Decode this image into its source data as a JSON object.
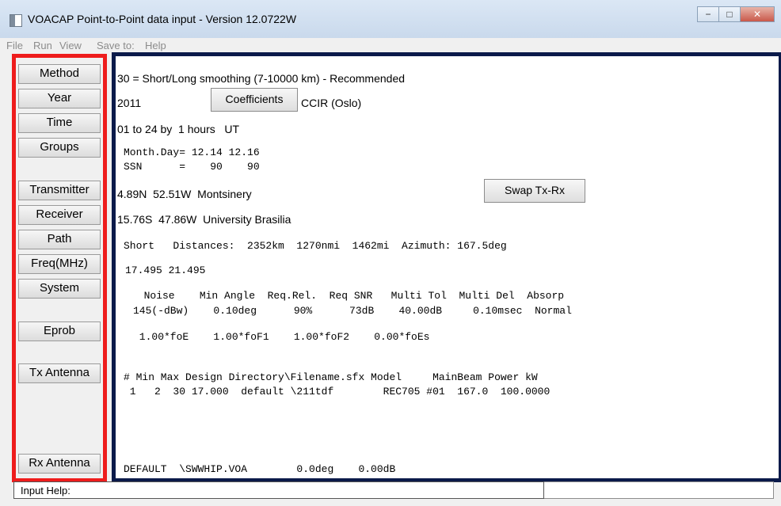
{
  "window": {
    "title": "VOACAP Point-to-Point data input - Version 12.0722W",
    "minimize_glyph": "−",
    "maximize_glyph": "□",
    "close_glyph": "✕"
  },
  "menu": [
    "File",
    "Run",
    "View",
    "Save to:",
    "Help"
  ],
  "sidebar": {
    "method": "Method",
    "year": "Year",
    "time": "Time",
    "groups": "Groups",
    "transmitter": "Transmitter",
    "receiver": "Receiver",
    "path": "Path",
    "freq": "Freq(MHz)",
    "system": "System",
    "eprob": "Eprob",
    "tx_antenna": "Tx Antenna",
    "rx_antenna": "Rx Antenna"
  },
  "main": {
    "method_line": "30 = Short/Long smoothing (7-10000 km) - Recommended",
    "year": "2011",
    "coefficients_button": "Coefficients",
    "coefficients_value": "CCIR (Oslo)",
    "time_line": "01 to 24 by  1 hours   UT",
    "month_day_line": "Month.Day= 12.14 12.16",
    "ssn_line": "SSN      =    90    90",
    "transmitter_line": "4.89N  52.51W  Montsinery",
    "swap_button": "Swap Tx-Rx",
    "receiver_line": "15.76S  47.86W  University Brasilia",
    "path_line": "Short   Distances:  2352km  1270nmi  1462mi  Azimuth: 167.5deg",
    "freq_line": "17.495 21.495",
    "system_header": "  Noise    Min Angle  Req.Rel.  Req SNR   Multi Tol  Multi Del  Absorp",
    "system_values": "145(-dBw)    0.10deg      90%      73dB    40.00dB     0.10msec  Normal",
    "eprob_line": " 1.00*foE    1.00*foF1    1.00*foF2    0.00*foEs",
    "tx_header": "# Min Max Design Directory\\Filename.sfx Model     MainBeam Power kW",
    "tx_values": " 1   2  30 17.000  default \\211tdf        REC705 #01  167.0  100.0000",
    "rx_line": "DEFAULT  \\SWWHIP.VOA        0.0deg    0.00dB"
  },
  "status": {
    "label": "Input Help:"
  }
}
